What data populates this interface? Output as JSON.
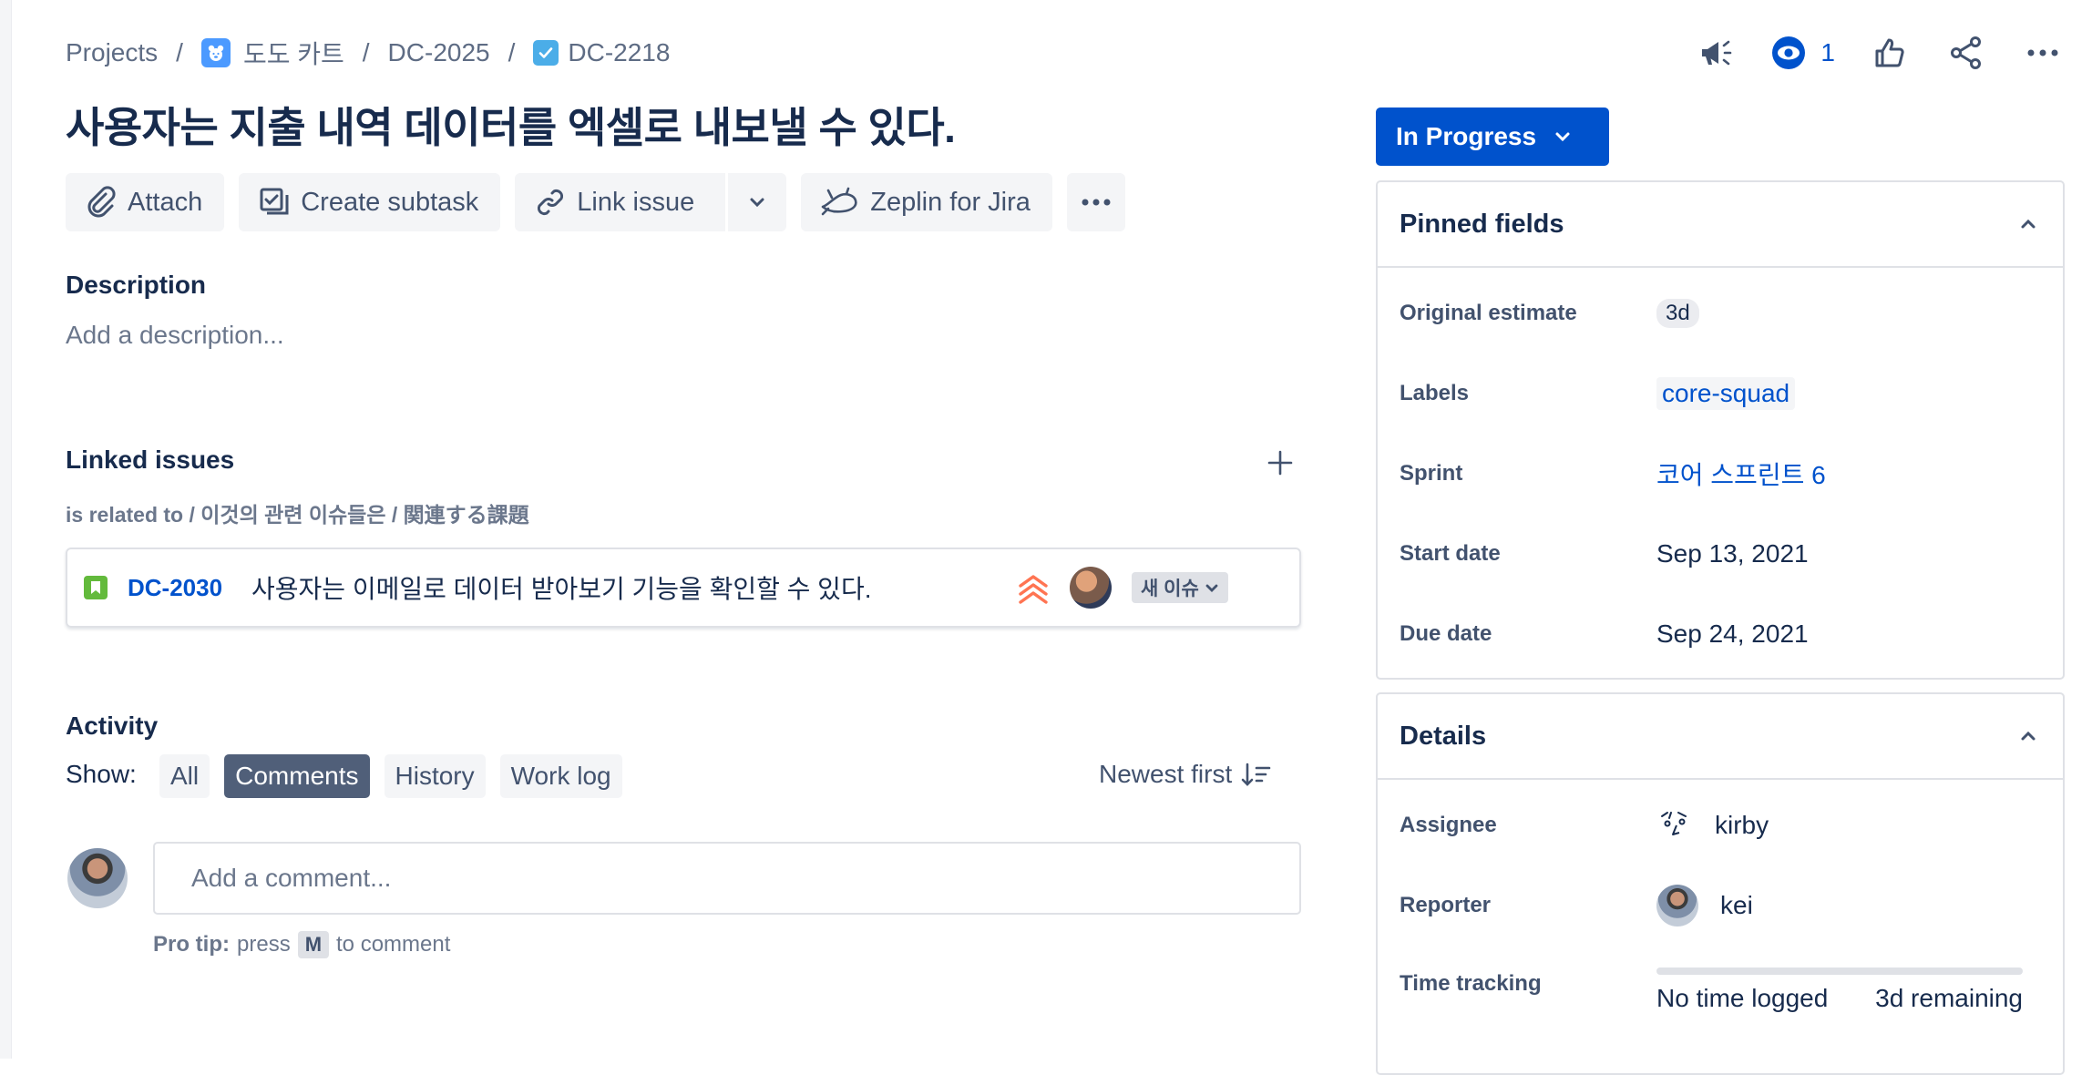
{
  "breadcrumbs": {
    "projects": "Projects",
    "project_name": "도도 카트",
    "epic": "DC-2025",
    "issue": "DC-2218",
    "separator": "/"
  },
  "header_actions": {
    "watch_count": "1"
  },
  "issue": {
    "title": "사용자는 지출 내역 데이터를 엑셀로 내보낼 수 있다."
  },
  "toolbar": {
    "attach": "Attach",
    "create_subtask": "Create subtask",
    "link_issue": "Link issue",
    "zeplin": "Zeplin for Jira"
  },
  "description": {
    "heading": "Description",
    "placeholder": "Add a description..."
  },
  "linked_issues": {
    "heading": "Linked issues",
    "relation": "is related to / 이것의 관련 이슈들은 / 関連する課題",
    "items": [
      {
        "key": "DC-2030",
        "summary": "사용자는 이메일로 데이터 받아보기 기능을 확인할 수 있다.",
        "status": "새 이슈",
        "priority": "highest"
      }
    ]
  },
  "activity": {
    "heading": "Activity",
    "show_label": "Show:",
    "filters": [
      "All",
      "Comments",
      "History",
      "Work log"
    ],
    "active_filter": "Comments",
    "sort": "Newest first",
    "comment_placeholder": "Add a comment...",
    "protip_prefix": "Pro tip:",
    "protip_press": "press",
    "protip_key": "M",
    "protip_suffix": "to comment"
  },
  "status": {
    "label": "In Progress"
  },
  "pinned_fields": {
    "heading": "Pinned fields",
    "original_estimate_label": "Original estimate",
    "original_estimate": "3d",
    "labels_label": "Labels",
    "labels": "core-squad",
    "sprint_label": "Sprint",
    "sprint": "코어 스프린트 6",
    "start_date_label": "Start date",
    "start_date": "Sep 13, 2021",
    "due_date_label": "Due date",
    "due_date": "Sep 24, 2021"
  },
  "details": {
    "heading": "Details",
    "assignee_label": "Assignee",
    "assignee": "kirby",
    "reporter_label": "Reporter",
    "reporter": "kei",
    "time_tracking_label": "Time tracking",
    "time_logged": "No time logged",
    "time_remaining": "3d remaining",
    "time_logged_fraction": 0
  },
  "colors": {
    "primary": "#0052cc",
    "text": "#172b4d",
    "subtle": "#42526e",
    "story": "#63ba3c",
    "priority_highest": "#ff7452"
  }
}
